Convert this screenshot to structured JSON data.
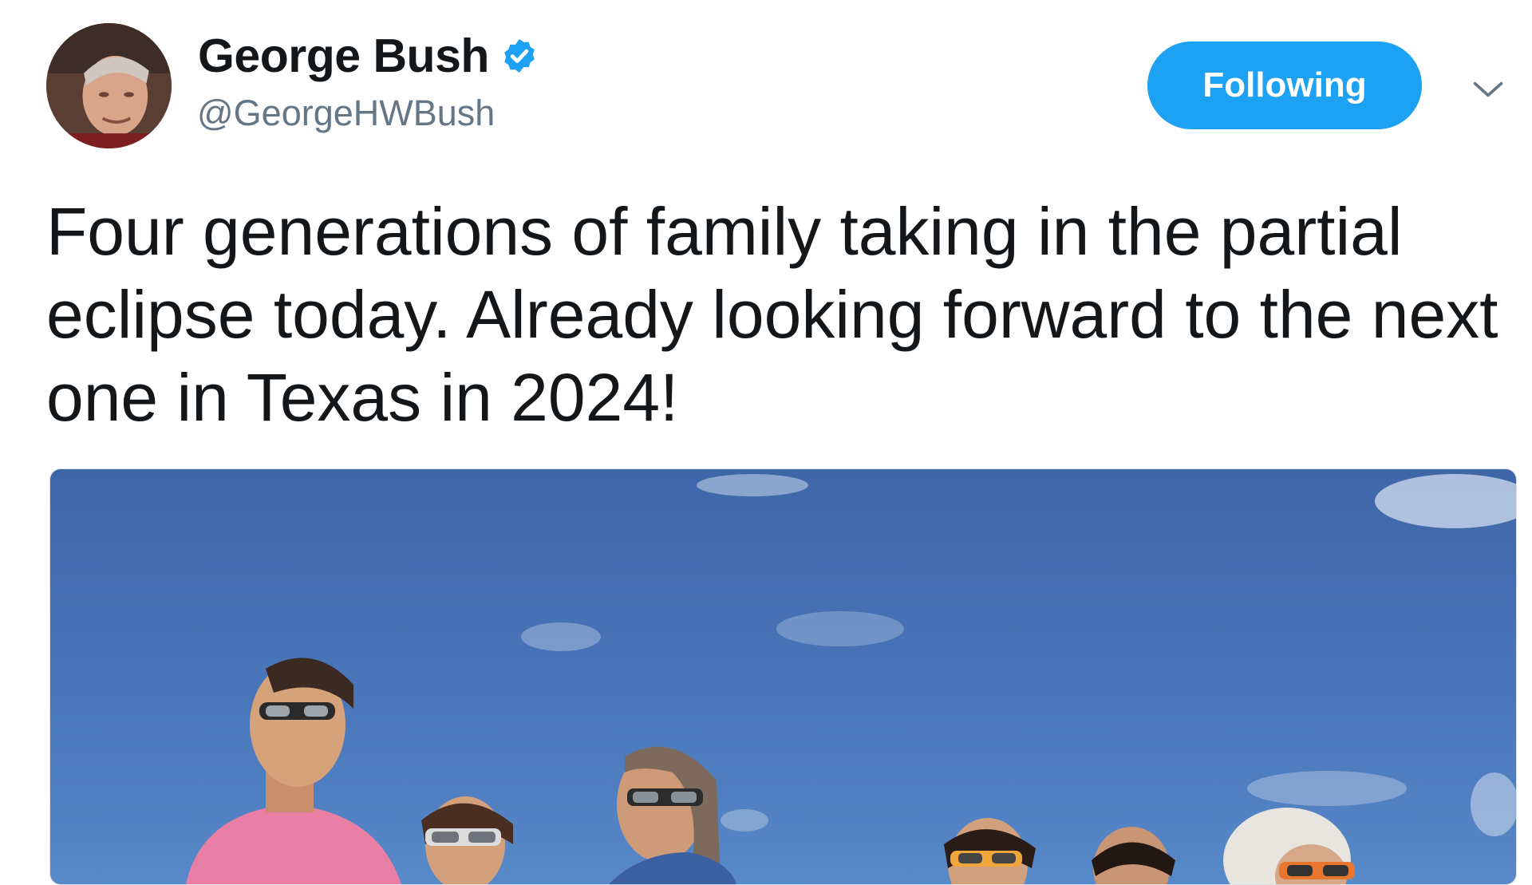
{
  "tweet": {
    "author": {
      "display_name": "George Bush",
      "handle": "@GeorgeHWBush",
      "verified": true,
      "avatar_icon": "profile-photo"
    },
    "follow_button_label": "Following",
    "menu_icon": "chevron-down-icon",
    "text": "Four generations of family taking in the partial eclipse today. Already looking forward to the next one in Texas in 2024!",
    "media": {
      "type": "photo",
      "content": "family looking up at the sky wearing eclipse glasses"
    }
  },
  "colors": {
    "accent": "#1da1f2",
    "text_primary": "#14171a",
    "text_secondary": "#657786",
    "sky": "#4a76b8"
  }
}
